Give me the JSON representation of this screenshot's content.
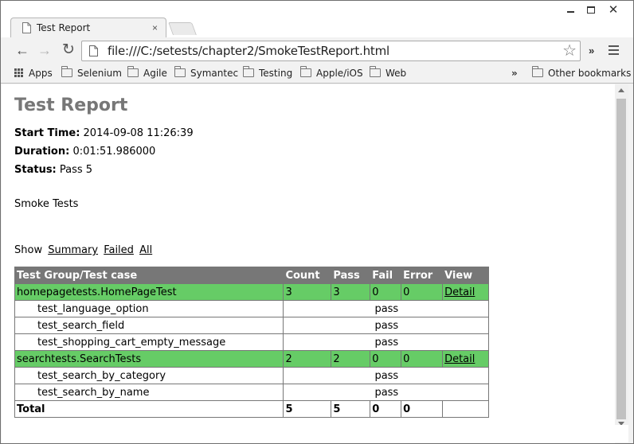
{
  "tab": {
    "title": "Test Report",
    "close_glyph": "×",
    "favicon": "page-icon"
  },
  "window_controls": {
    "close_glyph": "✕"
  },
  "toolbar": {
    "back_glyph": "←",
    "forward_glyph": "→",
    "reload_glyph": "↻",
    "url": "file:///C:/setests/chapter2/SmokeTestReport.html",
    "star_glyph": "☆",
    "overflow_glyph": "»"
  },
  "bookmarks": {
    "items": [
      {
        "label": "Apps",
        "icon": "apps-grid-icon"
      },
      {
        "label": "Selenium",
        "icon": "folder-icon"
      },
      {
        "label": "Agile",
        "icon": "folder-icon"
      },
      {
        "label": "Symantec",
        "icon": "folder-icon"
      },
      {
        "label": "Testing",
        "icon": "folder-icon"
      },
      {
        "label": "Apple/iOS",
        "icon": "folder-icon"
      },
      {
        "label": "Web",
        "icon": "folder-icon"
      }
    ],
    "overflow_glyph": "»",
    "other": "Other bookmarks"
  },
  "report": {
    "title": "Test Report",
    "start_label": "Start Time:",
    "start_value": "2014-09-08 11:26:39",
    "duration_label": "Duration:",
    "duration_value": "0:01:51.986000",
    "status_label": "Status:",
    "status_value": "Pass 5",
    "description": "Smoke Tests",
    "show_label": "Show",
    "show_links": [
      "Summary",
      "Failed",
      "All"
    ],
    "table": {
      "headers": [
        "Test Group/Test case",
        "Count",
        "Pass",
        "Fail",
        "Error",
        "View"
      ],
      "groups": [
        {
          "name": "homepagetests.HomePageTest",
          "count": "3",
          "pass": "3",
          "fail": "0",
          "error": "0",
          "view": "Detail",
          "cases": [
            {
              "name": "test_language_option",
              "result": "pass"
            },
            {
              "name": "test_search_field",
              "result": "pass"
            },
            {
              "name": "test_shopping_cart_empty_message",
              "result": "pass"
            }
          ]
        },
        {
          "name": "searchtests.SearchTests",
          "count": "2",
          "pass": "2",
          "fail": "0",
          "error": "0",
          "view": "Detail",
          "cases": [
            {
              "name": "test_search_by_category",
              "result": "pass"
            },
            {
              "name": "test_search_by_name",
              "result": "pass"
            }
          ]
        }
      ],
      "total": {
        "label": "Total",
        "count": "5",
        "pass": "5",
        "fail": "0",
        "error": "0"
      }
    }
  },
  "colors": {
    "group_row_bg": "#66cc66",
    "header_bg": "#777777",
    "title_color": "#777777"
  }
}
